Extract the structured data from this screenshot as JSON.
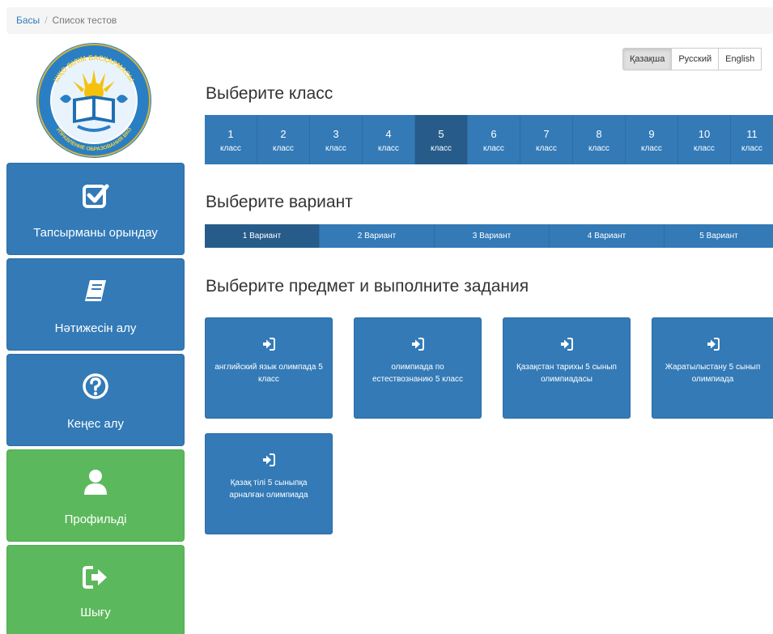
{
  "breadcrumb": {
    "home": "Басы",
    "separator": "/",
    "current": "Список тестов"
  },
  "logo": {
    "top_text": "ШҚО БІЛІМ БАСҚАРМАСЫ",
    "bottom_text": "УПРАВЛЕНИЕ ОБРАЗОВАНИЯ ВКО"
  },
  "sidebar": [
    {
      "label": "Тапсырманы орындау",
      "icon": "check-square-icon",
      "color": "#337ab7"
    },
    {
      "label": "Нәтижесін алу",
      "icon": "book-icon",
      "color": "#337ab7"
    },
    {
      "label": "Кеңес алу",
      "icon": "question-circle-icon",
      "color": "#337ab7"
    },
    {
      "label": "Профильді",
      "icon": "user-icon",
      "color": "#5cb85c"
    },
    {
      "label": "Шығу",
      "icon": "sign-out-icon",
      "color": "#5cb85c"
    }
  ],
  "languages": [
    {
      "label": "Қазақша",
      "active": true
    },
    {
      "label": "Русский",
      "active": false
    },
    {
      "label": "English",
      "active": false
    }
  ],
  "headings": {
    "class": "Выберите класс",
    "variant": "Выберите вариант",
    "subject": "Выберите предмет и выполните задания"
  },
  "classes": [
    {
      "num": "1",
      "word": "класс"
    },
    {
      "num": "2",
      "word": "класс"
    },
    {
      "num": "3",
      "word": "класс"
    },
    {
      "num": "4",
      "word": "класс"
    },
    {
      "num": "5",
      "word": "класс"
    },
    {
      "num": "6",
      "word": "класс"
    },
    {
      "num": "7",
      "word": "класс"
    },
    {
      "num": "8",
      "word": "класс"
    },
    {
      "num": "9",
      "word": "класс"
    },
    {
      "num": "10",
      "word": "класс"
    },
    {
      "num": "11",
      "word": "класс"
    }
  ],
  "selected_class": "5",
  "variants": [
    "1 Вариант",
    "2 Вариант",
    "3 Вариант",
    "4 Вариант",
    "5 Вариант"
  ],
  "selected_variant": "1 Вариант",
  "subjects": [
    {
      "label": "английский язык олимпада 5 класс",
      "icon": "sign-in-icon"
    },
    {
      "label": "олимпиада по естествознанию 5 класс",
      "icon": "sign-in-icon"
    },
    {
      "label": "Қазақстан тарихы 5 сынып олимпиадасы",
      "icon": "sign-in-icon"
    },
    {
      "label": "Жаратылыстану 5 сынып олимпиада",
      "icon": "sign-in-icon"
    },
    {
      "label": "Қазақ тілі 5 сыныпқа арналған олимпиада",
      "icon": "sign-in-icon"
    }
  ],
  "colors": {
    "primary": "#337ab7",
    "primary_active": "#275c8a",
    "success": "#5cb85c"
  }
}
